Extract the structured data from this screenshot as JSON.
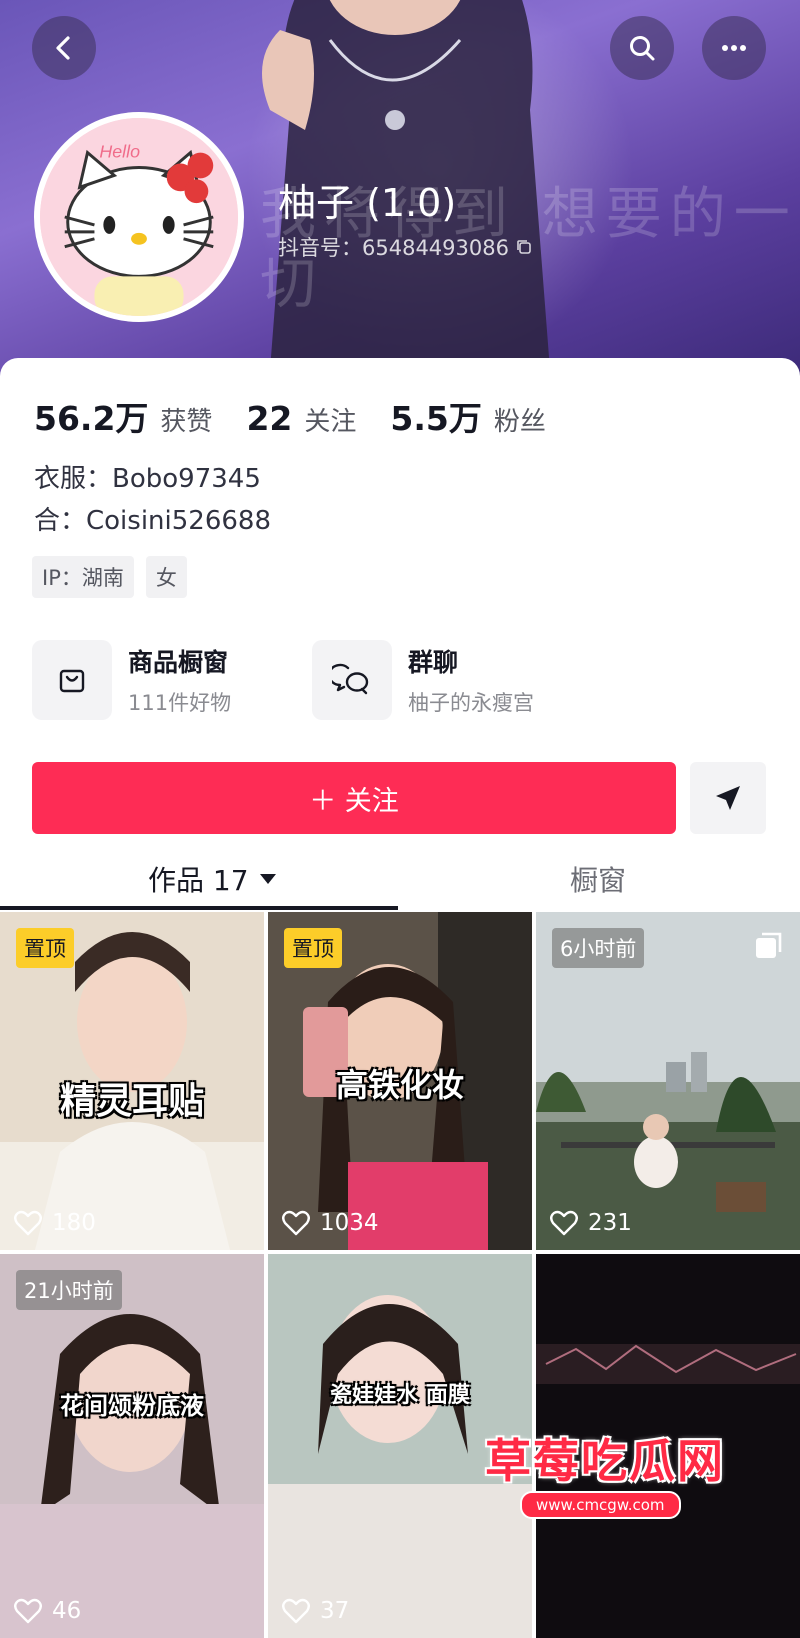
{
  "header": {
    "background_overlay_text": "我将得到 想要的一切",
    "icons": [
      "back-arrow-icon",
      "search-icon",
      "more-icon"
    ]
  },
  "profile": {
    "name": "柚子 (1.0)",
    "douyin_id": "抖音号：65484493086",
    "avatar_label": "Hello",
    "stats": [
      {
        "value": "56.2万",
        "label": "获赞"
      },
      {
        "value": "22",
        "label": "关注"
      },
      {
        "value": "5.5万",
        "label": "粉丝"
      }
    ],
    "bio_lines": [
      "衣服：Bobo97345",
      "合：Coisini526688"
    ],
    "tags": [
      "IP：湖南",
      "女"
    ]
  },
  "shortcuts": [
    {
      "title": "商品橱窗",
      "subtitle": "111件好物",
      "icon": "shop-bag-icon"
    },
    {
      "title": "群聊",
      "subtitle": "柚子的永瘦宫",
      "icon": "chat-bubbles-icon"
    }
  ],
  "actions": {
    "follow_label": "＋ 关注",
    "share_icon": "send-icon",
    "accent": "#fe2c55"
  },
  "tabs": {
    "works_label": "作品 17",
    "window_label": "橱窗"
  },
  "videos": [
    {
      "badge": "置顶",
      "badge_type": "pin",
      "caption": "精灵耳贴",
      "likes": "180"
    },
    {
      "badge": "置顶",
      "badge_type": "pin",
      "caption": "高铁化妆",
      "likes": "1034"
    },
    {
      "badge": "6小时前",
      "badge_type": "time",
      "caption": "",
      "likes": "231",
      "multi_image": true
    },
    {
      "badge": "21小时前",
      "badge_type": "time",
      "caption": "花间颂粉底液",
      "likes": "46"
    },
    {
      "badge": "",
      "badge_type": "",
      "caption": "瓷娃娃水 面膜",
      "likes": "37"
    },
    {
      "badge": "",
      "badge_type": "",
      "caption": "",
      "likes": ""
    }
  ],
  "watermark": {
    "title": "草莓吃瓜网",
    "url": "www.cmcgw.com"
  }
}
